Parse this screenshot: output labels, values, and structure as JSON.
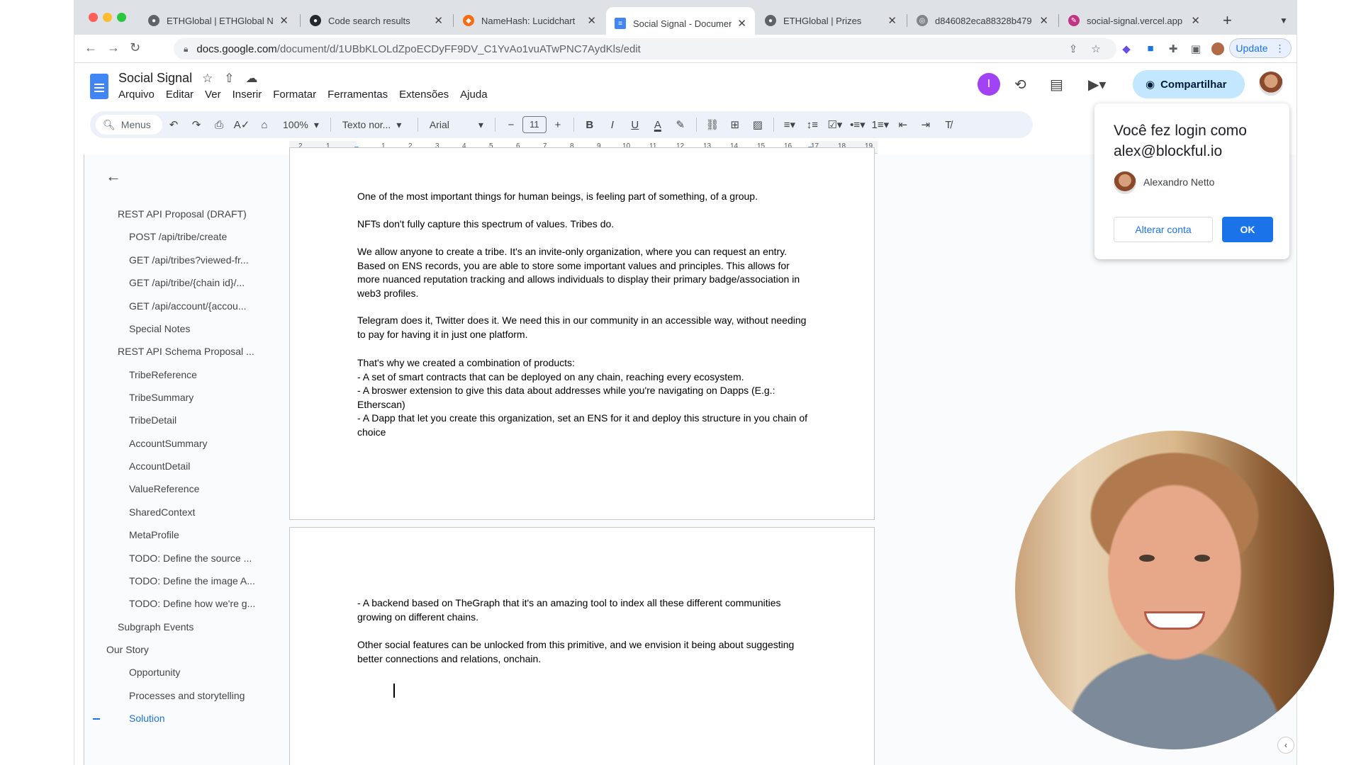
{
  "browser": {
    "tabs": [
      {
        "title": "ETHGlobal | ETHGlobal N",
        "favicon": "ethglobal-icon",
        "color": "#5f6368"
      },
      {
        "title": "Code search results",
        "favicon": "github-icon",
        "color": "#24292f"
      },
      {
        "title": "NameHash: Lucidchart",
        "favicon": "lucidchart-icon",
        "color": "#f96b13"
      },
      {
        "title": "Social Signal - Document",
        "favicon": "docs-icon",
        "color": "#4285f4"
      },
      {
        "title": "ETHGlobal | Prizes",
        "favicon": "ethglobal-icon",
        "color": "#5f6368"
      },
      {
        "title": "d846082eca88328b479",
        "favicon": "globe-icon",
        "color": "#5f6368"
      },
      {
        "title": "social-signal.vercel.app",
        "favicon": "pen-icon",
        "color": "#c13584"
      }
    ],
    "url_host": "docs.google.com",
    "url_path": "/document/d/1UBbKLOLdZpoECDyFF9DV_C1YvAo1vuATwPNC7AydKls/edit",
    "update_label": "Update"
  },
  "docs": {
    "title": "Social Signal",
    "menus": [
      "Arquivo",
      "Editar",
      "Ver",
      "Inserir",
      "Formatar",
      "Ferramentas",
      "Extensões",
      "Ajuda"
    ],
    "avatar_letter": "I",
    "share_label": "Compartilhar",
    "toolbar": {
      "search_label": "Menus",
      "zoom": "100%",
      "style": "Texto nor...",
      "font": "Arial",
      "font_size": "11"
    },
    "ruler_numbers": [
      "2",
      "1",
      "1",
      "2",
      "3",
      "4",
      "5",
      "6",
      "7",
      "8",
      "9",
      "10",
      "11",
      "12",
      "13",
      "14",
      "15",
      "16",
      "17",
      "18",
      "19"
    ]
  },
  "outline": {
    "items": [
      {
        "label": "REST API Proposal (DRAFT)",
        "level": 1,
        "active": false
      },
      {
        "label": "POST /api/tribe/create",
        "level": 2,
        "active": false
      },
      {
        "label": "GET /api/tribes?viewed-fr...",
        "level": 2,
        "active": false
      },
      {
        "label": "GET /api/tribe/{chain id}/...",
        "level": 2,
        "active": false
      },
      {
        "label": "GET /api/account/{accou...",
        "level": 2,
        "active": false
      },
      {
        "label": "Special Notes",
        "level": 2,
        "active": false
      },
      {
        "label": "REST API Schema Proposal ...",
        "level": 1,
        "active": false
      },
      {
        "label": "TribeReference",
        "level": 2,
        "active": false
      },
      {
        "label": "TribeSummary",
        "level": 2,
        "active": false
      },
      {
        "label": "TribeDetail",
        "level": 2,
        "active": false
      },
      {
        "label": "AccountSummary",
        "level": 2,
        "active": false
      },
      {
        "label": "AccountDetail",
        "level": 2,
        "active": false
      },
      {
        "label": "ValueReference",
        "level": 2,
        "active": false
      },
      {
        "label": "SharedContext",
        "level": 2,
        "active": false
      },
      {
        "label": "MetaProfile",
        "level": 2,
        "active": false
      },
      {
        "label": "TODO: Define the source ...",
        "level": 2,
        "active": false
      },
      {
        "label": "TODO: Define the image A...",
        "level": 2,
        "active": false
      },
      {
        "label": "TODO: Define how we're g...",
        "level": 2,
        "active": false
      },
      {
        "label": "Subgraph Events",
        "level": 1,
        "active": false
      },
      {
        "label": "Our Story",
        "level": 0,
        "active": false
      },
      {
        "label": "Opportunity",
        "level": 2,
        "active": false
      },
      {
        "label": "Processes and storytelling",
        "level": 2,
        "active": false
      },
      {
        "label": "Solution",
        "level": 2,
        "active": true
      }
    ]
  },
  "page1": {
    "p1": "One of the most important things for human beings, is feeling part of something, of a group.",
    "p2": "NFTs don't fully capture this spectrum of values. Tribes do.",
    "p3": "We allow anyone to create a tribe. It's an invite-only organization, where you can request an entry. Based on ENS records, you are able to store some important values and principles. This allows for more nuanced reputation tracking and allows individuals to display their primary badge/association in web3 profiles.",
    "p4": "Telegram does it, Twitter does it. We need this in our community in an accessible way, without needing to pay for having it in just one platform.",
    "p5_lines": [
      "That's why we created a combination of products:",
      "- A set of smart contracts that can be deployed on any chain, reaching every ecosystem.",
      "- A broswer extension to give this data about addresses while you're navigating on Dapps (E.g.: Etherscan)",
      "- A Dapp that let you create this organization, set an ENS for it and deploy this structure in you chain of choice"
    ]
  },
  "page2": {
    "p1": "- A backend based on TheGraph that it's an amazing tool to index all these different communities growing on different chains.",
    "p2": "Other social features can be unlocked from this primitive, and we envision it being about suggesting better connections and relations, onchain."
  },
  "login_popup": {
    "title": "Você fez login como alex@blockful.io",
    "name": "Alexandro Netto",
    "switch_label": "Alterar conta",
    "ok_label": "OK"
  }
}
